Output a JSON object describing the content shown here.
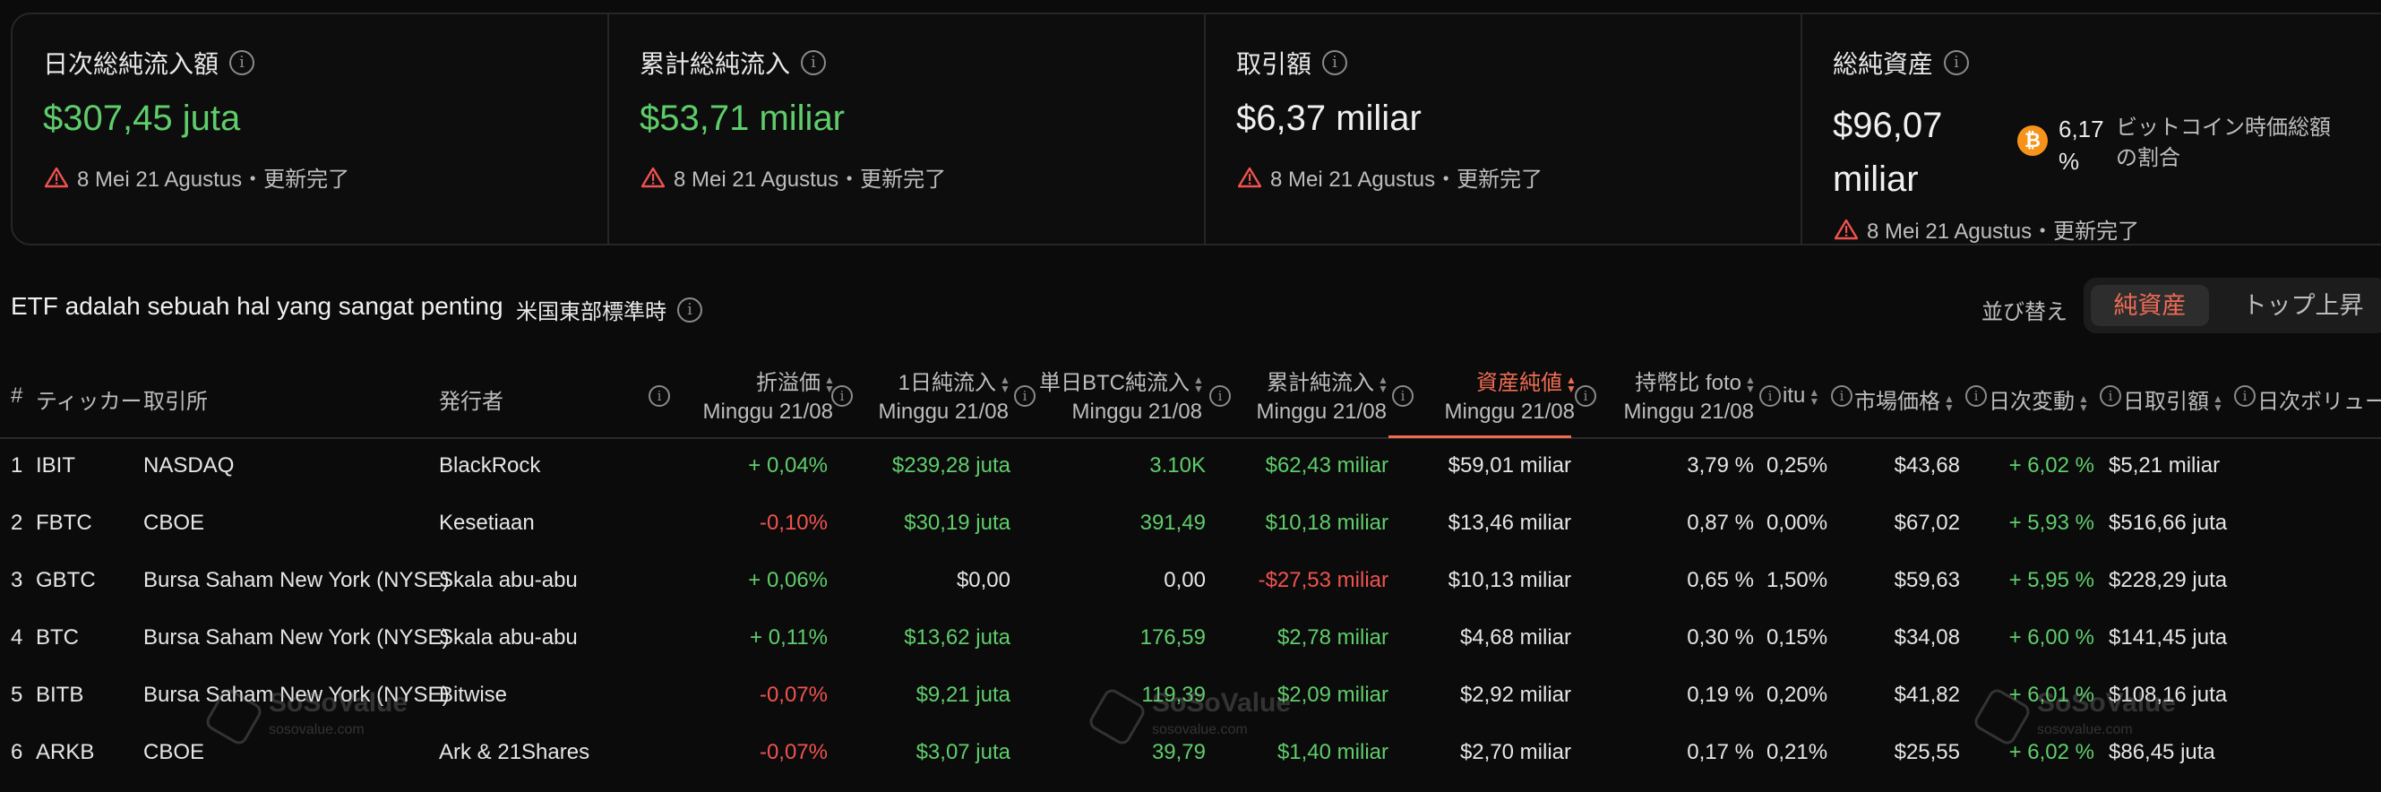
{
  "cards": [
    {
      "title": "日次総純流入額",
      "value": "$307,45 juta",
      "note": "8 Mei 21 Agustus・更新完了"
    },
    {
      "title": "累計総純流入",
      "value": "$53,71 miliar",
      "note": "8 Mei 21 Agustus・更新完了"
    },
    {
      "title": "取引額",
      "value": "$6,37 miliar",
      "note": "8 Mei 21 Agustus・更新完了"
    },
    {
      "title": "総純資産",
      "value": "$96,07 miliar",
      "note": "8 Mei 21 Agustus・更新完了",
      "btc_pct": "6,17 %",
      "btc_label": "ビットコイン時価総額の割合"
    }
  ],
  "toolbar": {
    "title": "ETF adalah sebuah hal yang sangat penting",
    "timezone": "米国東部標準時",
    "sort_label": "並び替え",
    "sort_options": [
      "純資産",
      "トップ上昇"
    ]
  },
  "columns": {
    "num": "#",
    "ticker": "ティッカー",
    "exchange": "取引所",
    "issuer": "発行者",
    "premium": "折溢価",
    "daily_inflow": "1日純流入",
    "daily_btc": "単日BTC純流入",
    "cum_inflow": "累計純流入",
    "nav": "資産純値",
    "holding_ratio": "持幣比 foto",
    "fee": "itu",
    "price": "市場価格",
    "change": "日次変動",
    "volume_value": "日取引額",
    "volume": "日次ボリュー",
    "date_sub": "Minggu 21/08"
  },
  "rows": [
    {
      "n": "1",
      "ticker": "IBIT",
      "exchange": "NASDAQ",
      "issuer": "BlackRock",
      "premium": "+ 0,04%",
      "inflow": "$239,28 juta",
      "btc": "3.10K",
      "cum": "$62,43 miliar",
      "nav": "$59,01 miliar",
      "ratio": "3,79 %",
      "fee": "0,25%",
      "price": "$43,68",
      "change": "+ 6,02 %",
      "vol": "$5,21 miliar"
    },
    {
      "n": "2",
      "ticker": "FBTC",
      "exchange": "CBOE",
      "issuer": "Kesetiaan",
      "premium": "-0,10%",
      "inflow": "$30,19 juta",
      "btc": "391,49",
      "cum": "$10,18 miliar",
      "nav": "$13,46 miliar",
      "ratio": "0,87 %",
      "fee": "0,00%",
      "price": "$67,02",
      "change": "+ 5,93 %",
      "vol": "$516,66 juta"
    },
    {
      "n": "3",
      "ticker": "GBTC",
      "exchange": "Bursa Saham New York (NYSE)",
      "issuer": "Skala abu-abu",
      "premium": "+ 0,06%",
      "inflow": "$0,00",
      "btc": "0,00",
      "cum": "-$27,53 miliar",
      "nav": "$10,13 miliar",
      "ratio": "0,65 %",
      "fee": "1,50%",
      "price": "$59,63",
      "change": "+ 5,95 %",
      "vol": "$228,29 juta"
    },
    {
      "n": "4",
      "ticker": "BTC",
      "exchange": "Bursa Saham New York (NYSE)",
      "issuer": "Skala abu-abu",
      "premium": "+ 0,11%",
      "inflow": "$13,62 juta",
      "btc": "176,59",
      "cum": "$2,78 miliar",
      "nav": "$4,68 miliar",
      "ratio": "0,30 %",
      "fee": "0,15%",
      "price": "$34,08",
      "change": "+ 6,00 %",
      "vol": "$141,45 juta"
    },
    {
      "n": "5",
      "ticker": "BITB",
      "exchange": "Bursa Saham New York (NYSE)",
      "issuer": "Bitwise",
      "premium": "-0,07%",
      "inflow": "$9,21 juta",
      "btc": "119,39",
      "cum": "$2,09 miliar",
      "nav": "$2,92 miliar",
      "ratio": "0,19 %",
      "fee": "0,20%",
      "price": "$41,82",
      "change": "+ 6,01 %",
      "vol": "$108,16 juta"
    },
    {
      "n": "6",
      "ticker": "ARKB",
      "exchange": "CBOE",
      "issuer": "Ark & 21Shares",
      "premium": "-0,07%",
      "inflow": "$3,07 juta",
      "btc": "39,79",
      "cum": "$1,40 miliar",
      "nav": "$2,70 miliar",
      "ratio": "0,17 %",
      "fee": "0,21%",
      "price": "$25,55",
      "change": "+ 6,02 %",
      "vol": "$86,45 juta"
    }
  ],
  "watermark": {
    "name": "SoSoValue",
    "url": "sosovalue.com"
  },
  "colors": {
    "positive": "#5fcd6b",
    "negative": "#ef5350",
    "accent": "#ef6c54"
  }
}
